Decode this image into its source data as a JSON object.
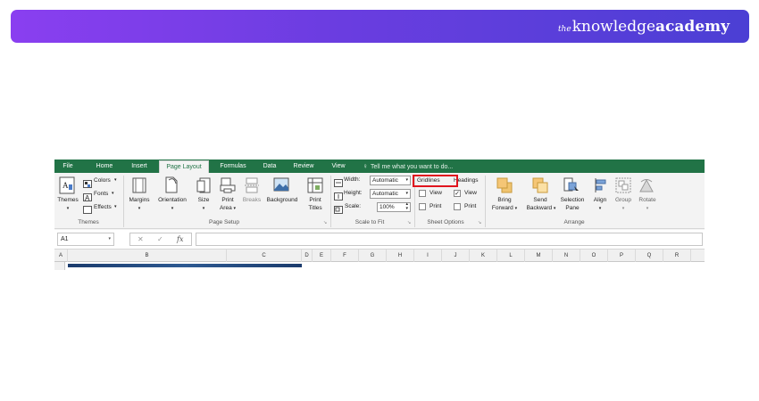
{
  "brand": {
    "the": "the",
    "knowledge": "knowledge",
    "academy": "academy"
  },
  "tabs": [
    "File",
    "Home",
    "Insert",
    "Page Layout",
    "Formulas",
    "Data",
    "Review",
    "View"
  ],
  "active_tab": "Page Layout",
  "tell_me": "Tell me what you want to do...",
  "ribbon": {
    "themes": {
      "themes": "Themes",
      "colors": "Colors",
      "fonts": "Fonts",
      "effects": "Effects",
      "group": "Themes"
    },
    "page_setup": {
      "margins": "Margins",
      "orientation": "Orientation",
      "size": "Size",
      "print": "Print",
      "area": "Area",
      "breaks": "Breaks",
      "background": "Background",
      "print_titles_1": "Print",
      "print_titles_2": "Titles",
      "group": "Page Setup"
    },
    "scale": {
      "width_label": "Width:",
      "width_value": "Automatic",
      "height_label": "Height:",
      "height_value": "Automatic",
      "scale_label": "Scale:",
      "scale_value": "100%",
      "group": "Scale to Fit"
    },
    "sheet_options": {
      "gridlines": "Gridlines",
      "headings": "Headings",
      "view": "View",
      "print": "Print",
      "group": "Sheet Options"
    },
    "arrange": {
      "bring_1": "Bring",
      "bring_2": "Forward",
      "send_1": "Send",
      "send_2": "Backward",
      "selection_1": "Selection",
      "selection_2": "Pane",
      "align": "Align",
      "group_btn": "Group",
      "rotate": "Rotate",
      "group": "Arrange"
    }
  },
  "formula_bar": {
    "name_box": "A1",
    "cancel": "✕",
    "enter": "✓",
    "fx": "fx",
    "formula": ""
  },
  "columns": [
    "A",
    "B",
    "C",
    "D",
    "E",
    "F",
    "G",
    "H",
    "I",
    "J",
    "K",
    "L",
    "M",
    "N",
    "O",
    "P",
    "Q",
    "R"
  ],
  "colors": {
    "excel_green": "#217346",
    "highlight": "#e0141e",
    "banner_start": "#8a3ff0",
    "banner_end": "#4b3fd4"
  }
}
